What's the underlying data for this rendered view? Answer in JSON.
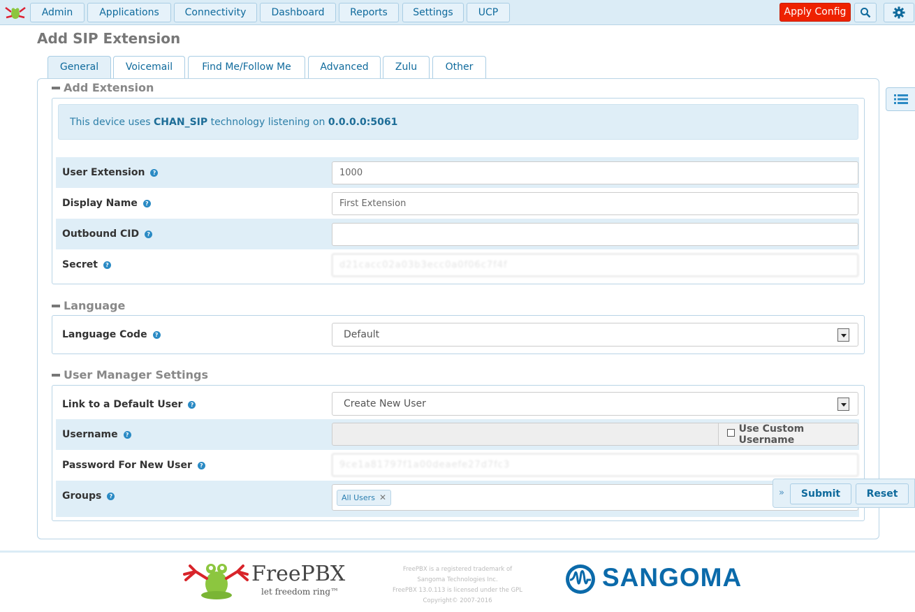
{
  "nav": {
    "items": [
      "Admin",
      "Applications",
      "Connectivity",
      "Dashboard",
      "Reports",
      "Settings",
      "UCP"
    ],
    "apply_config": "Apply Config"
  },
  "page_title": "Add SIP Extension",
  "tabs": [
    "General",
    "Voicemail",
    "Find Me/Follow Me",
    "Advanced",
    "Zulu",
    "Other"
  ],
  "sections": {
    "add_extension": "Add Extension",
    "language": "Language",
    "user_manager": "User Manager Settings"
  },
  "info": {
    "prefix": "This device uses ",
    "tech": "CHAN_SIP",
    "middle": " technology listening on ",
    "address": "0.0.0.0:5061"
  },
  "fields": {
    "user_extension": {
      "label": "User Extension",
      "value": "1000"
    },
    "display_name": {
      "label": "Display Name",
      "value": "First Extension"
    },
    "outbound_cid": {
      "label": "Outbound CID",
      "value": ""
    },
    "secret": {
      "label": "Secret",
      "value": "d21cacc02a03b3ecc0a0f06c7f4f"
    },
    "language_code": {
      "label": "Language Code",
      "value": "Default"
    },
    "link_default_user": {
      "label": "Link to a Default User",
      "value": "Create New User"
    },
    "username": {
      "label": "Username",
      "addon": "Use Custom Username"
    },
    "password_new_user": {
      "label": "Password For New User",
      "value": "9ce1a81797f1a00deaefe27d7fc3"
    },
    "groups": {
      "label": "Groups",
      "tag": "All Users"
    }
  },
  "actions": {
    "submit": "Submit",
    "reset": "Reset"
  },
  "footer": {
    "freepbx_name": "FreePBX",
    "freepbx_tagline": "let freedom ring™",
    "legal": [
      "FreePBX is a registered trademark of",
      "Sangoma Technologies Inc.",
      "FreePBX 13.0.113 is licensed under the GPL",
      "Copyright© 2007-2016"
    ],
    "sangoma": "SANGOMA"
  },
  "colors": {
    "accent": "#0f6a9c",
    "apply": "#ee2200",
    "shade": "#dfeef7"
  }
}
